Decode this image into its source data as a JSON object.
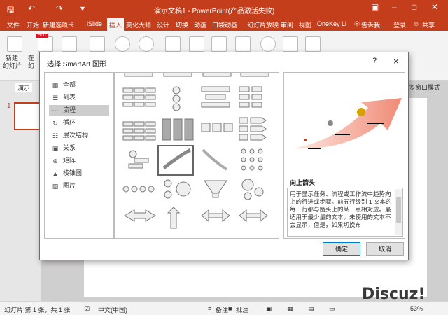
{
  "window": {
    "title": "演示文稿1 - PowerPoint(产品激活失败)"
  },
  "quick_access": {
    "save_icon": "save-icon",
    "undo_icon": "undo-icon",
    "redo_icon": "redo-icon"
  },
  "menu": {
    "tabs": [
      "文件",
      "开始",
      "新建选项卡",
      "iSlide",
      "插入",
      "美化大师",
      "设计",
      "切换",
      "动画",
      "口袋动画",
      "幻灯片放映",
      "审阅",
      "视图",
      "OneKey Li"
    ],
    "active": "插入",
    "tell_me": "告诉我...",
    "login": "登录",
    "share": "共享"
  },
  "ribbon": {
    "new_slide_line1": "新建",
    "new_slide_line2": "幻灯片",
    "fragment1": "在",
    "fragment2": "幻",
    "hot_badge": "HOT"
  },
  "left_pane": {
    "tab_label": "演示",
    "slide_number": "1"
  },
  "right_hint": "多窗口模式",
  "dialog": {
    "title": "选择 SmartArt 图形",
    "help": "?",
    "close": "×",
    "categories": [
      {
        "label": "全部",
        "icon": "all-icon"
      },
      {
        "label": "列表",
        "icon": "list-icon"
      },
      {
        "label": "流程",
        "icon": "process-icon"
      },
      {
        "label": "循环",
        "icon": "cycle-icon"
      },
      {
        "label": "层次结构",
        "icon": "hierarchy-icon"
      },
      {
        "label": "关系",
        "icon": "relationship-icon"
      },
      {
        "label": "矩阵",
        "icon": "matrix-icon"
      },
      {
        "label": "棱锥图",
        "icon": "pyramid-icon"
      },
      {
        "label": "图片",
        "icon": "picture-icon"
      }
    ],
    "selected_category": "流程",
    "preview": {
      "name": "向上箭头",
      "description": "用于显示任务、流程或工作流中趋势向上的行进或步骤。前五行级别 1 文本的每一行都与箭头上的某一点相对应。最适用于最少量的文本。未使用的文本不会显示，但是，如果切换布"
    },
    "ok": "确定",
    "cancel": "取消"
  },
  "status": {
    "slide_info": "幻灯片 第 1 张，共 1 张",
    "language": "中文(中国)",
    "notes": "备注",
    "comments": "批注",
    "zoom": "53%"
  },
  "watermark": "Discuz!",
  "colors": {
    "brand": "#c43e1c",
    "ribbon": "#f3f3f3",
    "ok_border": "#0078d7"
  }
}
